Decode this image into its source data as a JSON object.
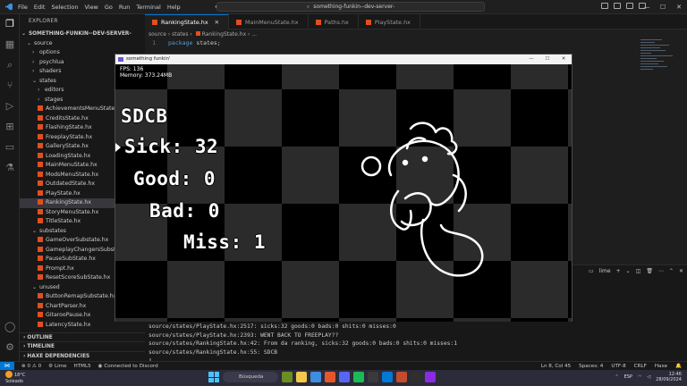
{
  "titlebar": {
    "menu": [
      "File",
      "Edit",
      "Selection",
      "View",
      "Go",
      "Run",
      "Terminal",
      "Help"
    ],
    "search": "something-funkin--dev-server-"
  },
  "explorer": {
    "header": "EXPLORER",
    "root": "SOMETHING-FUNKIN--DEV-SERVER-",
    "rows": [
      {
        "label": "source",
        "kind": "folder-open",
        "depth": 1
      },
      {
        "label": "options",
        "kind": "folder",
        "depth": 2
      },
      {
        "label": "psychlua",
        "kind": "folder",
        "depth": 2
      },
      {
        "label": "shaders",
        "kind": "folder",
        "depth": 2
      },
      {
        "label": "states",
        "kind": "folder-open",
        "depth": 2
      },
      {
        "label": "editors",
        "kind": "folder",
        "depth": 3
      },
      {
        "label": "stages",
        "kind": "folder",
        "depth": 3
      },
      {
        "label": "AchievementsMenuState.hx",
        "kind": "file",
        "depth": 3
      },
      {
        "label": "CreditsState.hx",
        "kind": "file",
        "depth": 3
      },
      {
        "label": "FlashingState.hx",
        "kind": "file",
        "depth": 3
      },
      {
        "label": "FreeplayState.hx",
        "kind": "file",
        "depth": 3
      },
      {
        "label": "GalleryState.hx",
        "kind": "file",
        "depth": 3
      },
      {
        "label": "LoadingState.hx",
        "kind": "file",
        "depth": 3
      },
      {
        "label": "MainMenuState.hx",
        "kind": "file",
        "depth": 3
      },
      {
        "label": "ModsMenuState.hx",
        "kind": "file",
        "depth": 3
      },
      {
        "label": "OutdatedState.hx",
        "kind": "file",
        "depth": 3
      },
      {
        "label": "PlayState.hx",
        "kind": "file",
        "depth": 3
      },
      {
        "label": "RankingState.hx",
        "kind": "file",
        "depth": 3,
        "selected": true
      },
      {
        "label": "StoryMenuState.hx",
        "kind": "file",
        "depth": 3
      },
      {
        "label": "TitleState.hx",
        "kind": "file",
        "depth": 3
      },
      {
        "label": "substates",
        "kind": "folder-open",
        "depth": 2
      },
      {
        "label": "GameOverSubstate.hx",
        "kind": "file",
        "depth": 3
      },
      {
        "label": "GameplayChangersSubstate.hx",
        "kind": "file",
        "depth": 3
      },
      {
        "label": "PauseSubState.hx",
        "kind": "file",
        "depth": 3
      },
      {
        "label": "Prompt.hx",
        "kind": "file",
        "depth": 3
      },
      {
        "label": "ResetScoreSubState.hx",
        "kind": "file",
        "depth": 3
      },
      {
        "label": "unused",
        "kind": "folder-open",
        "depth": 2
      },
      {
        "label": "ButtonRemapSubstate.hx",
        "kind": "file",
        "depth": 3
      },
      {
        "label": "ChartParser.hx",
        "kind": "file",
        "depth": 3
      },
      {
        "label": "GitarooPause.hx",
        "kind": "file",
        "depth": 3
      },
      {
        "label": "LatencyState.hx",
        "kind": "file",
        "depth": 3
      }
    ],
    "sections": [
      "OUTLINE",
      "TIMELINE",
      "HAXE DEPENDENCIES"
    ]
  },
  "tabs": [
    {
      "label": "RankingState.hx",
      "active": true
    },
    {
      "label": "MainMenuState.hx",
      "active": false
    },
    {
      "label": "Paths.hx",
      "active": false
    },
    {
      "label": "PlayState.hx",
      "active": false
    }
  ],
  "breadcrumb": {
    "part1": "source",
    "part2": "states",
    "file": "RankingState.hx",
    "tail": "..."
  },
  "editor": {
    "line_number": "1",
    "keyword": "package",
    "rest": "states;"
  },
  "panel": {
    "terminal_name": "lime"
  },
  "terminal": {
    "lines": [
      "source/states/PlayState.hx:2517: sicks:32 goods:0 bads:0 shits:0 misses:0",
      "source/states/PlayState.hx:2393: WENT BACK TO FREEPLAY??",
      "source/states/RankingState.hx:42: From da ranking, sicks:32 goods:0 bads:0 shits:0 misses:1",
      "source/states/RankingState.hx:55: SDCB"
    ]
  },
  "game": {
    "window_title": "something funkin'",
    "fps": "FPS: 136",
    "memory": "Memory: 373.24MB",
    "rank": "SDCB",
    "sick": "Sick: 32",
    "good": "Good: 0",
    "bad": "Bad: 0",
    "miss": "Miss: 1"
  },
  "statusbar": {
    "errors": "0",
    "warnings": "0",
    "target": "Lime",
    "build": "HTML5",
    "discord": "Connected to Discord",
    "position": "Ln 8, Col 45",
    "spaces": "Spaces: 4",
    "encoding": "UTF-8",
    "eol": "CRLF",
    "language": "Haxe"
  },
  "taskbar": {
    "temp": "18°C",
    "weather": "Soleado",
    "search": "Búsqueda",
    "lang": "ESP",
    "time": "12:46",
    "date": "28/09/2024"
  },
  "colors": {
    "accent": "#0078d4",
    "haxe_file": "#e14f1f"
  }
}
